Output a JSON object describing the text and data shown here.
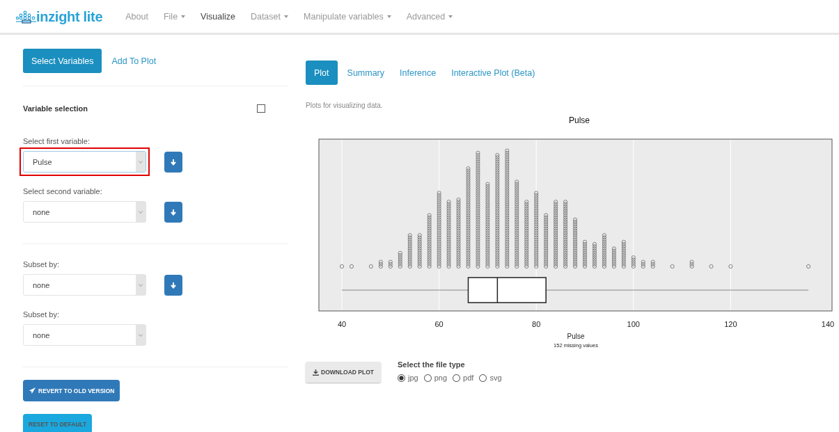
{
  "navbar": {
    "logo": "inzight lite",
    "items": [
      {
        "label": "About",
        "selected": false,
        "dropdown": false
      },
      {
        "label": "File",
        "selected": false,
        "dropdown": true
      },
      {
        "label": "Visualize",
        "selected": true,
        "dropdown": false
      },
      {
        "label": "Dataset",
        "selected": false,
        "dropdown": true
      },
      {
        "label": "Manipulate variables",
        "selected": false,
        "dropdown": true
      },
      {
        "label": "Advanced",
        "selected": false,
        "dropdown": true
      }
    ]
  },
  "left_tabs": [
    {
      "label": "Select Variables",
      "selected": true
    },
    {
      "label": "Add To Plot",
      "selected": false
    }
  ],
  "variable_selection": {
    "title": "Variable selection",
    "checked": false
  },
  "variable_selects": [
    {
      "label": "Select first variable:",
      "value": "Pulse",
      "highlighted": true,
      "arrow_button": true
    },
    {
      "label": "Select second variable:",
      "value": "none",
      "highlighted": false,
      "arrow_button": true
    }
  ],
  "subset_selects": [
    {
      "label": "Subset by:",
      "value": "none",
      "highlighted": false,
      "arrow_button": true
    },
    {
      "label": "Subset by:",
      "value": "none",
      "highlighted": false,
      "arrow_button": false
    }
  ],
  "revert_button": "REVERT TO OLD VERSION",
  "reset_button": "RESET TO DEFAULT",
  "right_tabs": [
    {
      "label": "Plot",
      "selected": true
    },
    {
      "label": "Summary",
      "selected": false
    },
    {
      "label": "Inference",
      "selected": false
    },
    {
      "label": "Interactive Plot (Beta)",
      "selected": false
    }
  ],
  "description": "Plots for visualizing data.",
  "plot": {
    "title": "Pulse",
    "xlabel": "Pulse",
    "note": "152 missing values",
    "xticks": [
      "40",
      "60",
      "80",
      "100",
      "120",
      "140"
    ]
  },
  "download_button": "DOWNLOAD PLOT",
  "file_type": {
    "label": "Select the file type",
    "options": [
      {
        "label": "jpg",
        "selected": true
      },
      {
        "label": "png",
        "selected": false
      },
      {
        "label": "pdf",
        "selected": false
      },
      {
        "label": "svg",
        "selected": false
      }
    ]
  }
}
